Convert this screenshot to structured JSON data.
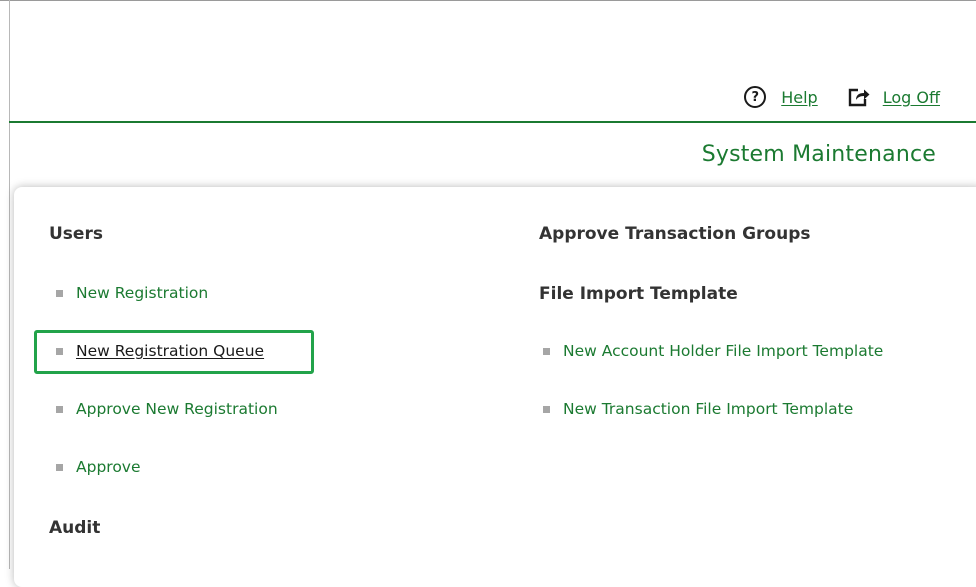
{
  "header": {
    "help_label": "Help",
    "logoff_label": "Log Off",
    "page_title": "System Maintenance"
  },
  "icons": {
    "help": "question-circle-icon",
    "logoff": "share-arrow-icon"
  },
  "menu": {
    "left": {
      "users_heading": "Users",
      "items": [
        "New Registration",
        "New Registration Queue",
        "Approve New Registration",
        "Approve"
      ],
      "audit_heading": "Audit"
    },
    "right": {
      "approve_groups_heading": "Approve Transaction Groups",
      "file_import_heading": "File Import Template",
      "items": [
        "New Account Holder File Import Template",
        "New Transaction File Import Template"
      ]
    },
    "highlighted_item": "New Registration Queue"
  },
  "colors": {
    "accent_green": "#1b7a31",
    "highlight_green": "#22a34a",
    "heading_text": "#333333",
    "bullet_gray": "#a6a6a6"
  }
}
